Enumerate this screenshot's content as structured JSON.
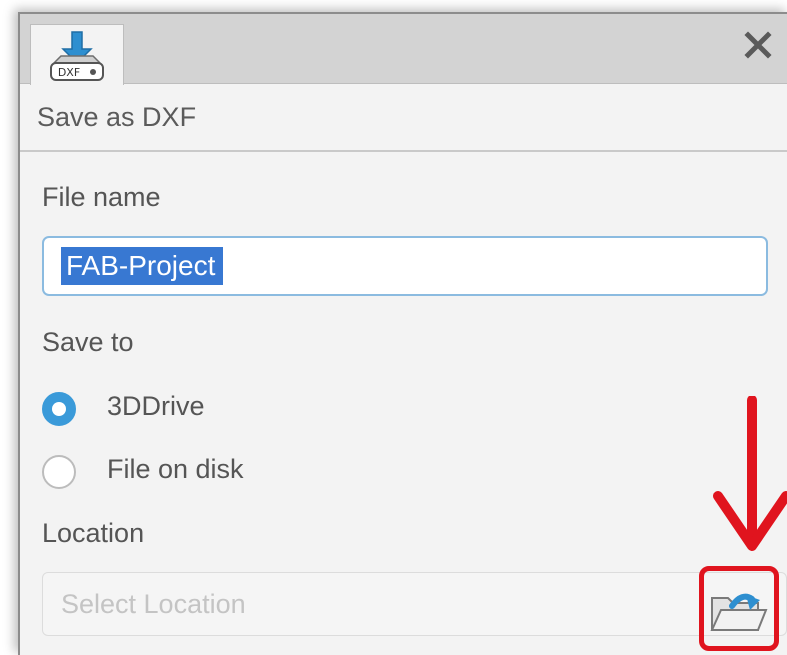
{
  "window": {
    "tab_icon": "dxf-file-icon",
    "tab_icon_text": "DXF",
    "close_icon": "close-icon",
    "close_symbol": "✕"
  },
  "dialog": {
    "title": "Save as DXF",
    "file_name_label": "File name",
    "file_name_value": "FAB-Project",
    "save_to_label": "Save to",
    "save_to_options": [
      {
        "label": "3DDrive",
        "selected": true
      },
      {
        "label": "File on disk",
        "selected": false
      }
    ],
    "location_label": "Location",
    "location_placeholder": "Select Location",
    "browse_icon": "folder-open-icon"
  },
  "annotation": {
    "color": "#e0141e",
    "arrow_icon": "arrow-down-icon"
  }
}
